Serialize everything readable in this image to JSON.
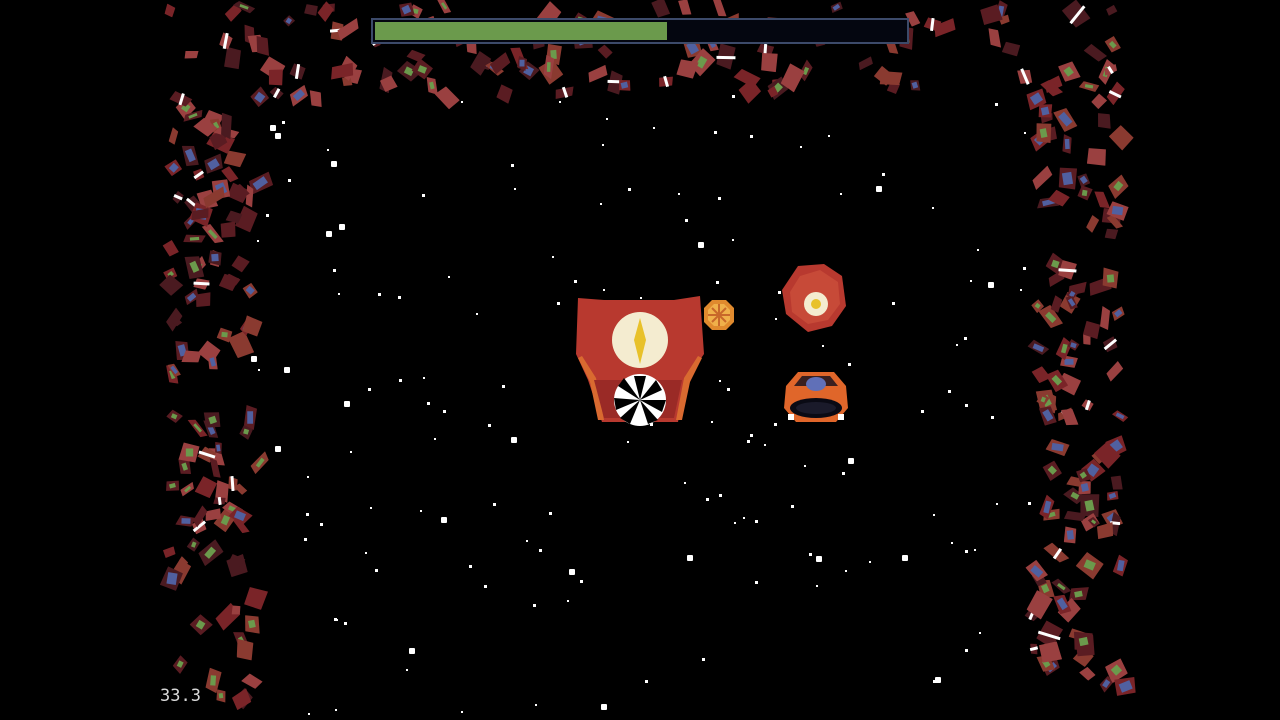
{
  "hud": {
    "timer_text": "33.3",
    "health_fraction": 0.55,
    "health_color": "#6b9a4c",
    "health_border_color": "#3c4a6a"
  },
  "palette": {
    "background": "#000000",
    "debris_colors": [
      "#7a2428",
      "#5a1c22",
      "#8a3a30",
      "#4a1a20",
      "#9a4040"
    ],
    "accent_green": "#6b9a4c",
    "accent_blue": "#5060a0"
  },
  "entities": {
    "boss": "cyclops-mothership",
    "projectile": "orange-orb",
    "enemy_drone": "red-eye-asteroid",
    "player": "player-pod-ship"
  }
}
